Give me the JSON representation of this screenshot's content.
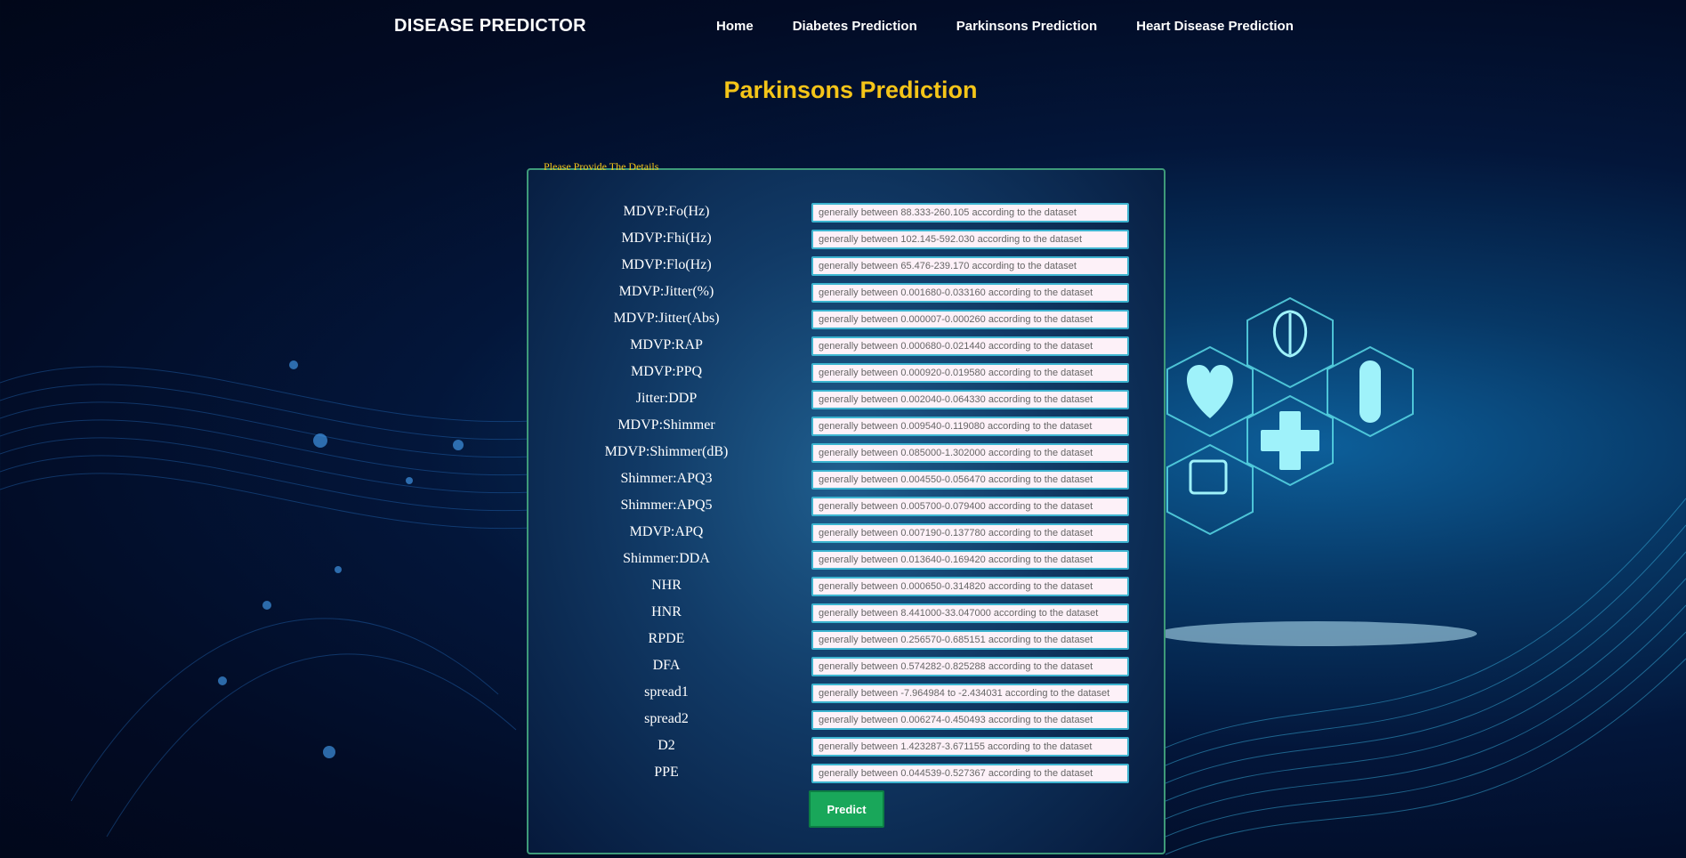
{
  "brand": "DISEASE PREDICTOR",
  "nav": [
    "Home",
    "Diabetes Prediction",
    "Parkinsons Prediction",
    "Heart Disease Prediction"
  ],
  "page_title": "Parkinsons Prediction",
  "form": {
    "legend": "Please Provide The Details",
    "fields": [
      {
        "label": "MDVP:Fo(Hz)",
        "placeholder": "generally between 88.333-260.105 according to the dataset"
      },
      {
        "label": "MDVP:Fhi(Hz)",
        "placeholder": "generally between 102.145-592.030 according to the dataset"
      },
      {
        "label": "MDVP:Flo(Hz)",
        "placeholder": "generally between 65.476-239.170 according to the dataset"
      },
      {
        "label": "MDVP:Jitter(%)",
        "placeholder": "generally between 0.001680-0.033160 according to the dataset"
      },
      {
        "label": "MDVP:Jitter(Abs)",
        "placeholder": "generally between 0.000007-0.000260 according to the dataset"
      },
      {
        "label": "MDVP:RAP",
        "placeholder": "generally between 0.000680-0.021440 according to the dataset"
      },
      {
        "label": "MDVP:PPQ",
        "placeholder": "generally between 0.000920-0.019580 according to the dataset"
      },
      {
        "label": "Jitter:DDP",
        "placeholder": "generally between 0.002040-0.064330 according to the dataset"
      },
      {
        "label": "MDVP:Shimmer",
        "placeholder": "generally between 0.009540-0.119080 according to the dataset"
      },
      {
        "label": "MDVP:Shimmer(dB)",
        "placeholder": "generally between 0.085000-1.302000 according to the dataset"
      },
      {
        "label": "Shimmer:APQ3",
        "placeholder": "generally between 0.004550-0.056470 according to the dataset"
      },
      {
        "label": "Shimmer:APQ5",
        "placeholder": "generally between 0.005700-0.079400 according to the dataset"
      },
      {
        "label": "MDVP:APQ",
        "placeholder": "generally between 0.007190-0.137780 according to the dataset"
      },
      {
        "label": "Shimmer:DDA",
        "placeholder": "generally between 0.013640-0.169420 according to the dataset"
      },
      {
        "label": "NHR",
        "placeholder": "generally between 0.000650-0.314820 according to the dataset"
      },
      {
        "label": "HNR",
        "placeholder": "generally between 8.441000-33.047000 according to the dataset"
      },
      {
        "label": "RPDE",
        "placeholder": "generally between 0.256570-0.685151 according to the dataset"
      },
      {
        "label": "DFA",
        "placeholder": "generally between 0.574282-0.825288 according to the dataset"
      },
      {
        "label": "spread1",
        "placeholder": "generally between -7.964984 to -2.434031 according to the dataset"
      },
      {
        "label": "spread2",
        "placeholder": "generally between 0.006274-0.450493 according to the dataset"
      },
      {
        "label": "D2",
        "placeholder": "generally between 1.423287-3.671155 according to the dataset"
      },
      {
        "label": "PPE",
        "placeholder": "generally between 0.044539-0.527367 according to the dataset"
      }
    ],
    "submit_label": "Predict"
  }
}
